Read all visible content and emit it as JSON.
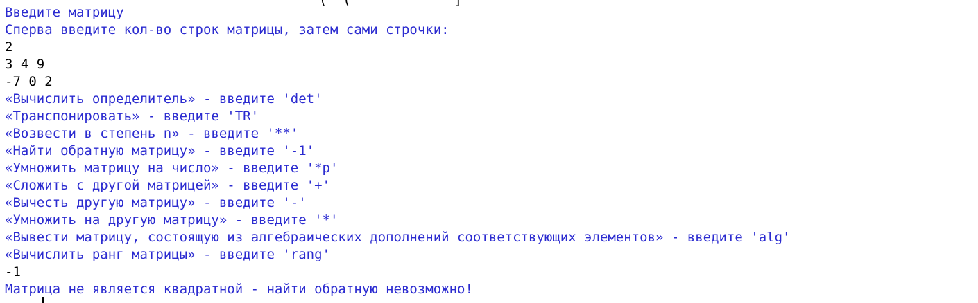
{
  "console": {
    "top_fragment": "(  (             ]",
    "lines": [
      {
        "text": "Введите матрицу",
        "kind": "out"
      },
      {
        "text": "Сперва введите кол-во строк матрицы, затем сами строчки:",
        "kind": "out"
      },
      {
        "text": "2",
        "kind": "in"
      },
      {
        "text": "3 4 9",
        "kind": "in"
      },
      {
        "text": "-7 0 2",
        "kind": "in"
      },
      {
        "text": "«Вычислить определитель» - введите 'det'",
        "kind": "out"
      },
      {
        "text": "«Транспонировать» - введите 'TR'",
        "kind": "out"
      },
      {
        "text": "«Возвести в степень n» - введите '**'",
        "kind": "out"
      },
      {
        "text": "«Найти обратную матрицу» - введите '-1'",
        "kind": "out"
      },
      {
        "text": "«Умножить матрицу на число» - введите '*p'",
        "kind": "out"
      },
      {
        "text": "«Сложить с другой матрицей» - введите '+'",
        "kind": "out"
      },
      {
        "text": "«Вычесть другую матрицу» - введите '-'",
        "kind": "out"
      },
      {
        "text": "«Умножить на другую матрицу» - введите '*'",
        "kind": "out"
      },
      {
        "text": "«Вывести матрицу, состоящую из алгебраических дополнений соответствующих элементов» - введите 'alg'",
        "kind": "out"
      },
      {
        "text": "«Вычислить ранг матрицы» - введите 'rang'",
        "kind": "out"
      },
      {
        "text": "-1",
        "kind": "in"
      },
      {
        "text": "Матрица не является квадратной - найти обратную невозможно!",
        "kind": "out"
      }
    ],
    "colors": {
      "program_output": "#2b2bd0",
      "user_input": "#000000",
      "background": "#ffffff"
    }
  }
}
